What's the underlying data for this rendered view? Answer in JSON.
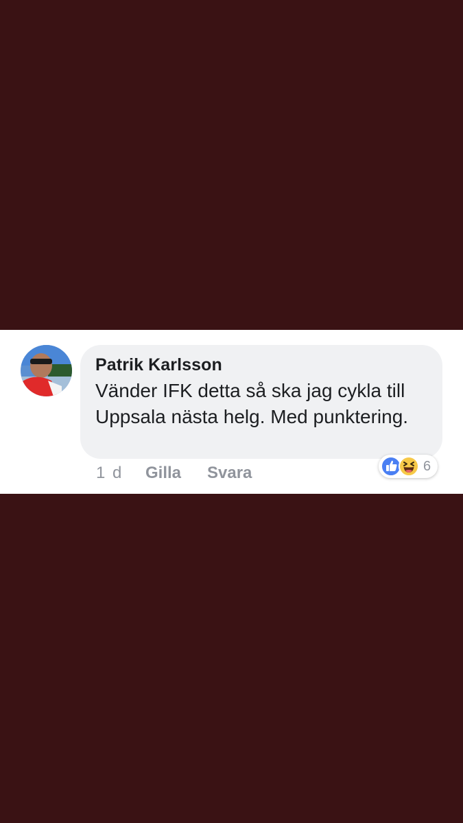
{
  "comment": {
    "author": "Patrik Karlsson",
    "text": "Vänder IFK detta så ska jag cykla till Uppsala nästa helg. Med punktering.",
    "time": "1 d",
    "like_label": "Gilla",
    "reply_label": "Svara",
    "reactions": {
      "icons": [
        "like-icon",
        "haha-icon"
      ],
      "count": "6"
    }
  },
  "colors": {
    "background": "#3a1214",
    "bubble": "#f0f1f3",
    "like_blue": "#4a7ff3",
    "haha_yellow": "#f7c948",
    "meta_gray": "#90949c"
  }
}
